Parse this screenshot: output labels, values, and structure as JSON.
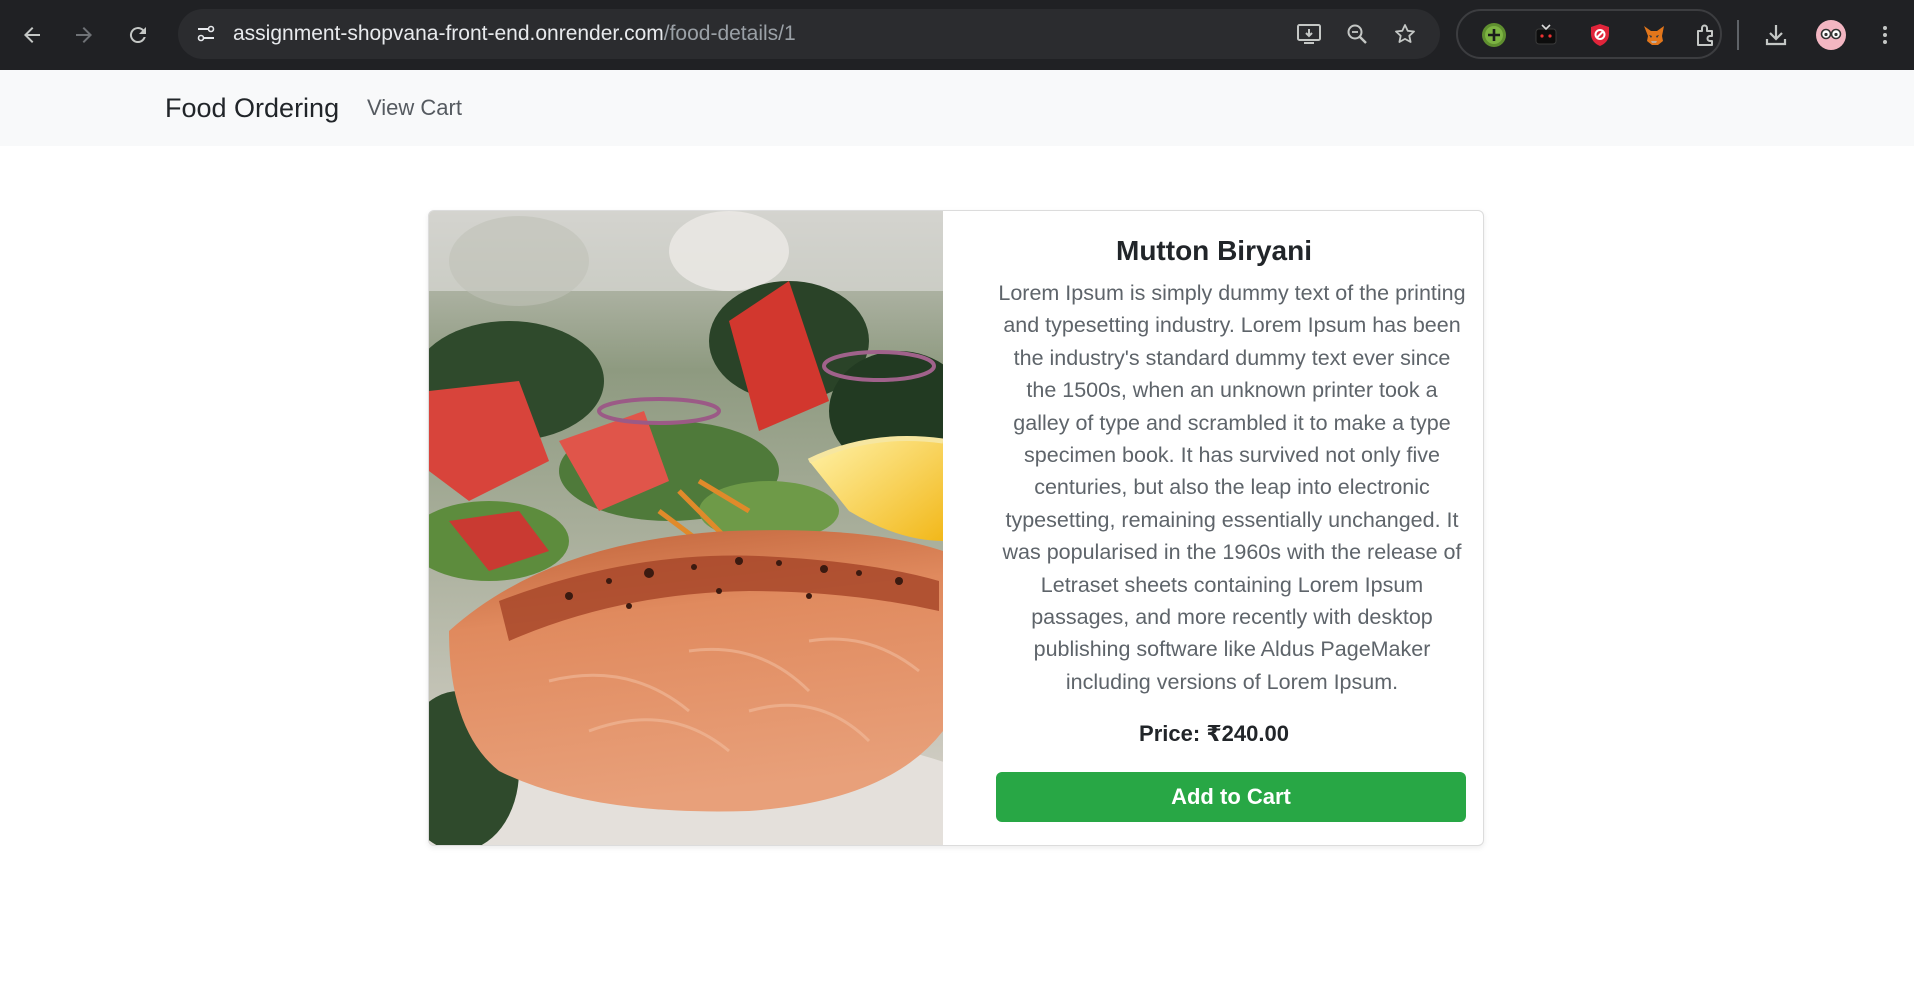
{
  "browser": {
    "url_host": "assignment-shopvana-front-end.onrender.com",
    "url_path": "/food-details/1"
  },
  "navbar": {
    "brand": "Food Ordering",
    "view_cart": "View Cart"
  },
  "food": {
    "name": "Mutton Biryani",
    "description": "Lorem Ipsum is simply dummy text of the printing and typesetting industry. Lorem Ipsum has been the industry's standard dummy text ever since the 1500s, when an unknown printer took a galley of type and scrambled it to make a type specimen book. It has survived not only five centuries, but also the leap into electronic typesetting, remaining essentially unchanged. It was popularised in the 1960s with the release of Letraset sheets containing Lorem Ipsum passages, and more recently with desktop publishing software like Aldus PageMaker including versions of Lorem Ipsum.",
    "price_label": "Price:",
    "price_value": "₹240.00",
    "add_to_cart": "Add to Cart"
  },
  "colors": {
    "chrome_bg": "#202124",
    "navbar_bg": "#f8f9fa",
    "accent_green": "#28a745"
  }
}
